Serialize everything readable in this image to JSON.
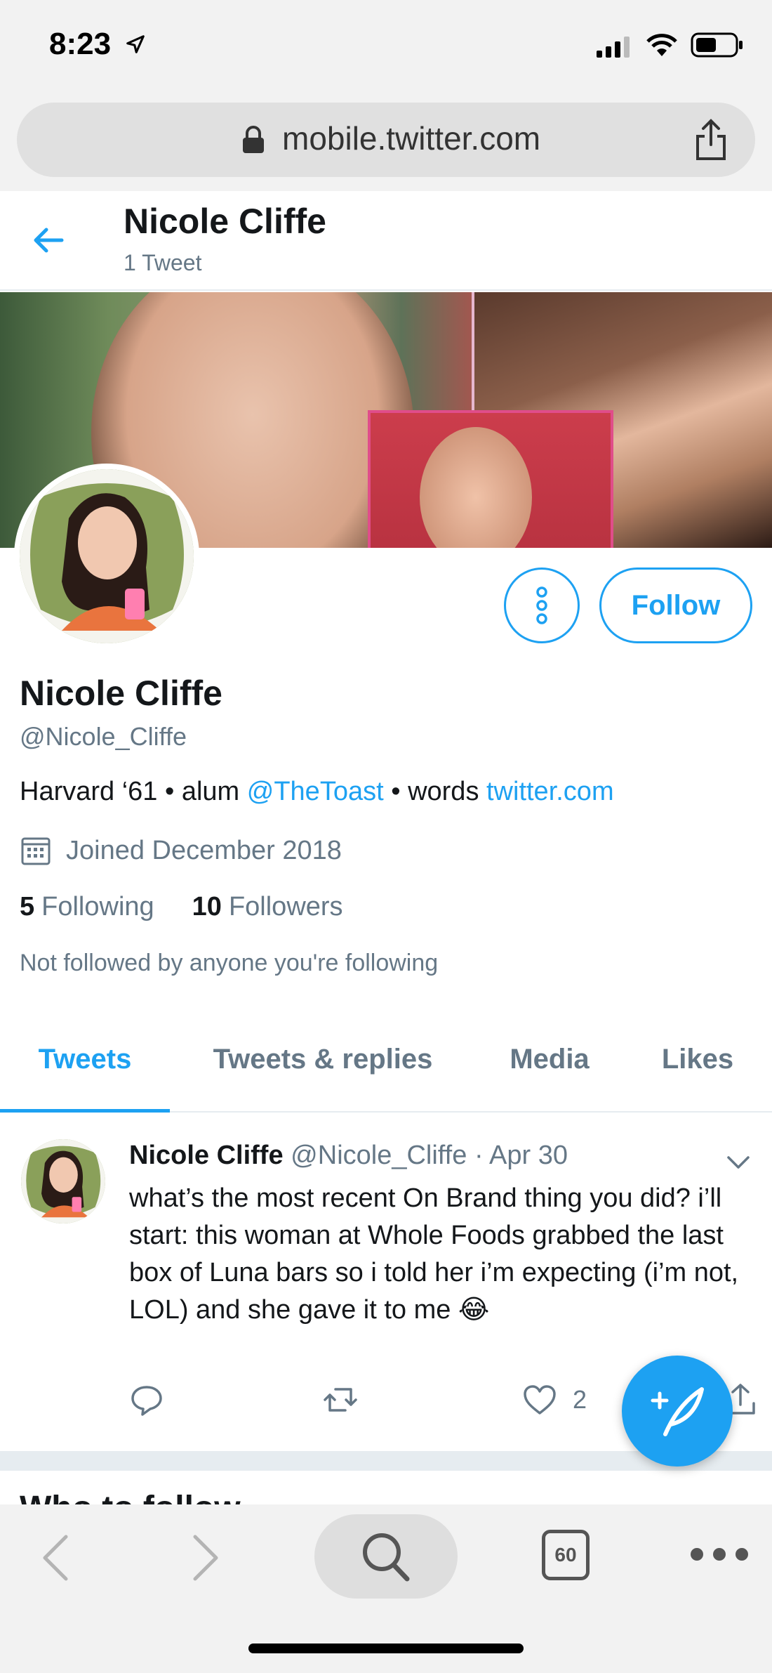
{
  "status_bar": {
    "time": "8:23"
  },
  "browser": {
    "url": "mobile.twitter.com",
    "tab_count": "60"
  },
  "header": {
    "name": "Nicole Cliffe",
    "tweet_count": "1 Tweet"
  },
  "profile": {
    "name": "Nicole Cliffe",
    "handle": "@Nicole_Cliffe",
    "bio_prefix": "Harvard ‘61 • alum ",
    "bio_mention": "@TheToast",
    "bio_middle": " • words ",
    "bio_link": "twitter.com",
    "joined": "Joined December 2018",
    "following_count": "5",
    "following_label": "Following",
    "followers_count": "10",
    "followers_label": "Followers",
    "not_followed": "Not followed by anyone you're following",
    "follow_label": "Follow"
  },
  "tabs": [
    {
      "label": "Tweets",
      "active": true
    },
    {
      "label": "Tweets & replies",
      "active": false
    },
    {
      "label": "Media",
      "active": false
    },
    {
      "label": "Likes",
      "active": false
    }
  ],
  "tweet": {
    "name": "Nicole Cliffe",
    "handle": "@Nicole_Cliffe",
    "date": "· Apr 30",
    "text": "what’s the most recent On Brand thing you did? i’ll start: this woman at Whole Foods grabbed the last box of Luna bars so i told her i’m expecting (i’m not, LOL) and she gave it to me 😂",
    "likes": "2"
  },
  "who_to_follow_peek": "Who to follow",
  "colors": {
    "accent": "#1da1f2",
    "secondary_text": "#657786",
    "divider": "#e6ecf0"
  },
  "icons": [
    "location-arrow-icon",
    "signal-icon",
    "wifi-icon",
    "battery-icon",
    "lock-icon",
    "share-icon",
    "back-arrow-icon",
    "more-vertical-icon",
    "calendar-icon",
    "reply-icon",
    "retweet-icon",
    "like-icon",
    "share-tweet-icon",
    "chevron-down-icon",
    "compose-icon",
    "search-icon"
  ]
}
